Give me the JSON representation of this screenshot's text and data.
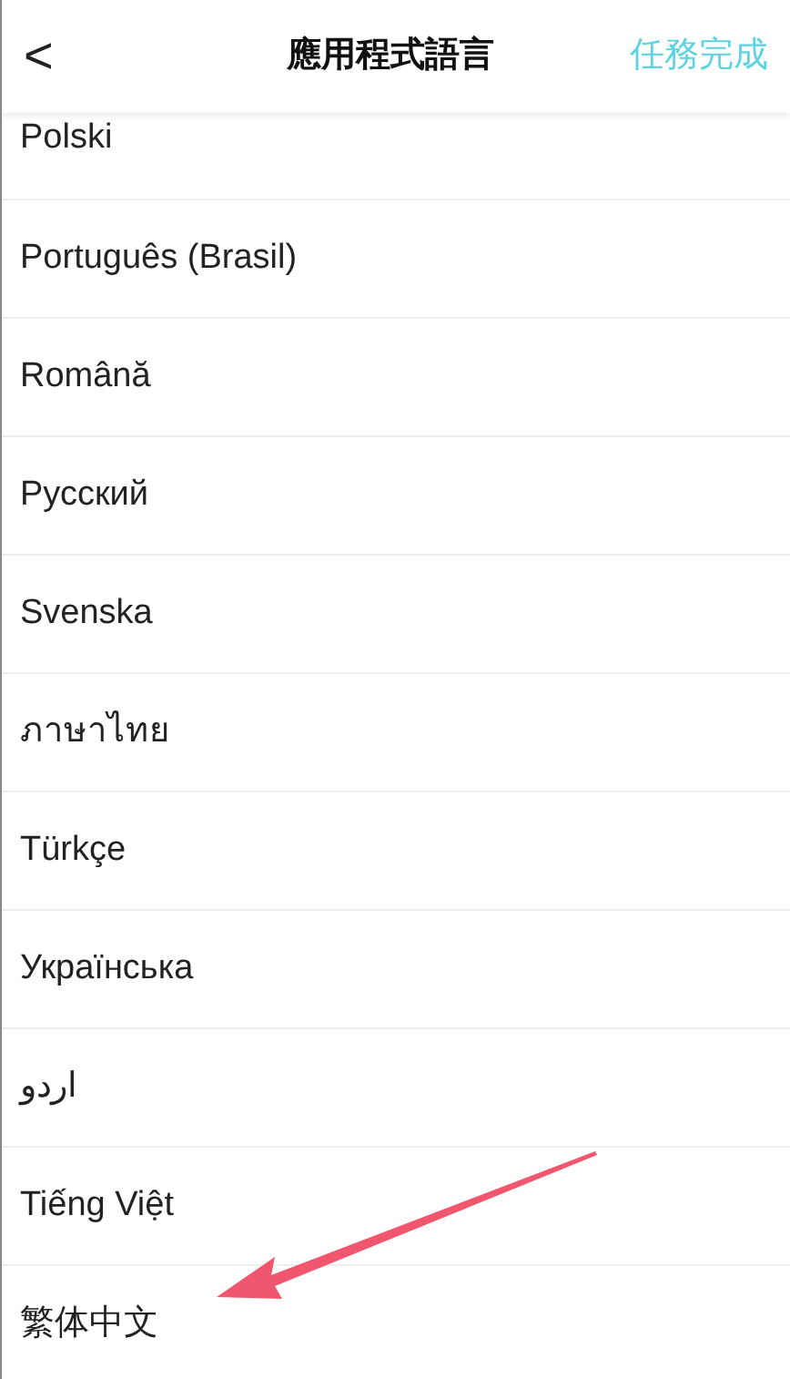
{
  "header": {
    "back": "<",
    "title": "應用程式語言",
    "done": "任務完成"
  },
  "languages": [
    "Polski",
    "Português (Brasil)",
    "Română",
    "Русский",
    "Svenska",
    "ภาษาไทย",
    "Türkçe",
    "Українська",
    "اردو",
    "Tiếng Việt",
    "繁体中文"
  ]
}
